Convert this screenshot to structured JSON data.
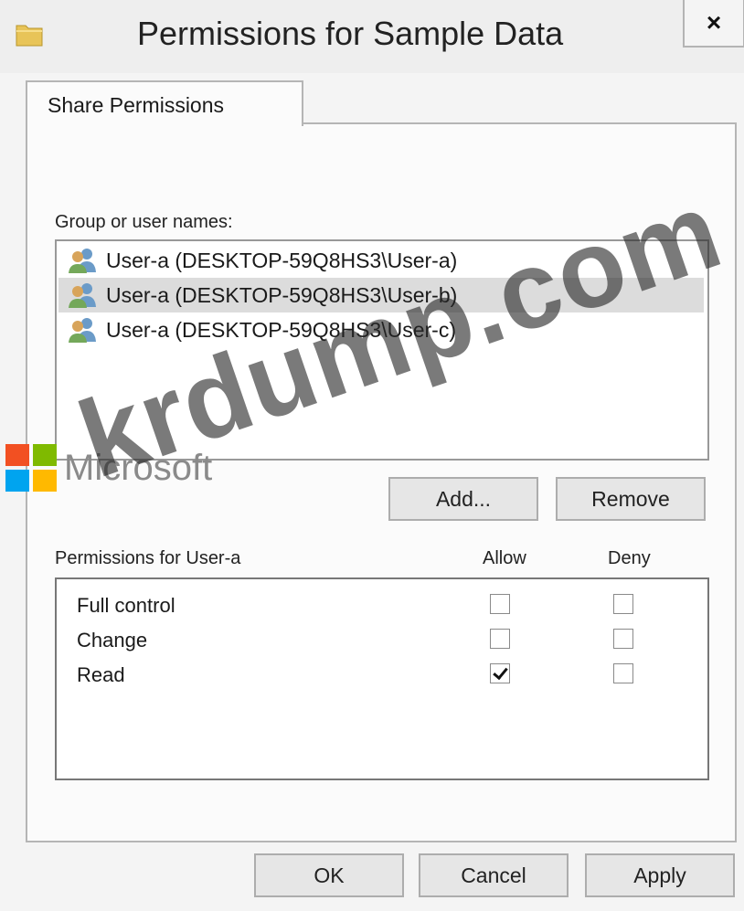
{
  "window": {
    "title": "Permissions for Sample Data",
    "close_glyph": "×"
  },
  "tabs": [
    {
      "label": "Share Permissions",
      "active": true
    }
  ],
  "users": {
    "label": "Group or user names:",
    "items": [
      {
        "label": "User-a (DESKTOP-59Q8HS3\\User-a)",
        "selected": false
      },
      {
        "label": "User-a (DESKTOP-59Q8HS3\\User-b)",
        "selected": true
      },
      {
        "label": "User-a (DESKTOP-59Q8HS3\\User-c)",
        "selected": false
      }
    ],
    "add_label": "Add...",
    "remove_label": "Remove"
  },
  "permissions": {
    "label": "Permissions for User-a",
    "allow_header": "Allow",
    "deny_header": "Deny",
    "rows": [
      {
        "name": "Full control",
        "allow": false,
        "deny": false
      },
      {
        "name": "Change",
        "allow": false,
        "deny": false
      },
      {
        "name": "Read",
        "allow": true,
        "deny": false
      }
    ]
  },
  "footer": {
    "ok_label": "OK",
    "cancel_label": "Cancel",
    "apply_label": "Apply"
  },
  "overlay": {
    "watermark_text": "krdump.com",
    "brand_text": "Microsoft"
  },
  "icons": {
    "window": "folder-icon",
    "user": "users-icon",
    "close": "close-icon"
  },
  "colors": {
    "selection": "#dcdcdc",
    "ms_red": "#f25022",
    "ms_green": "#7fba00",
    "ms_blue": "#00a4ef",
    "ms_yellow": "#ffb900"
  }
}
